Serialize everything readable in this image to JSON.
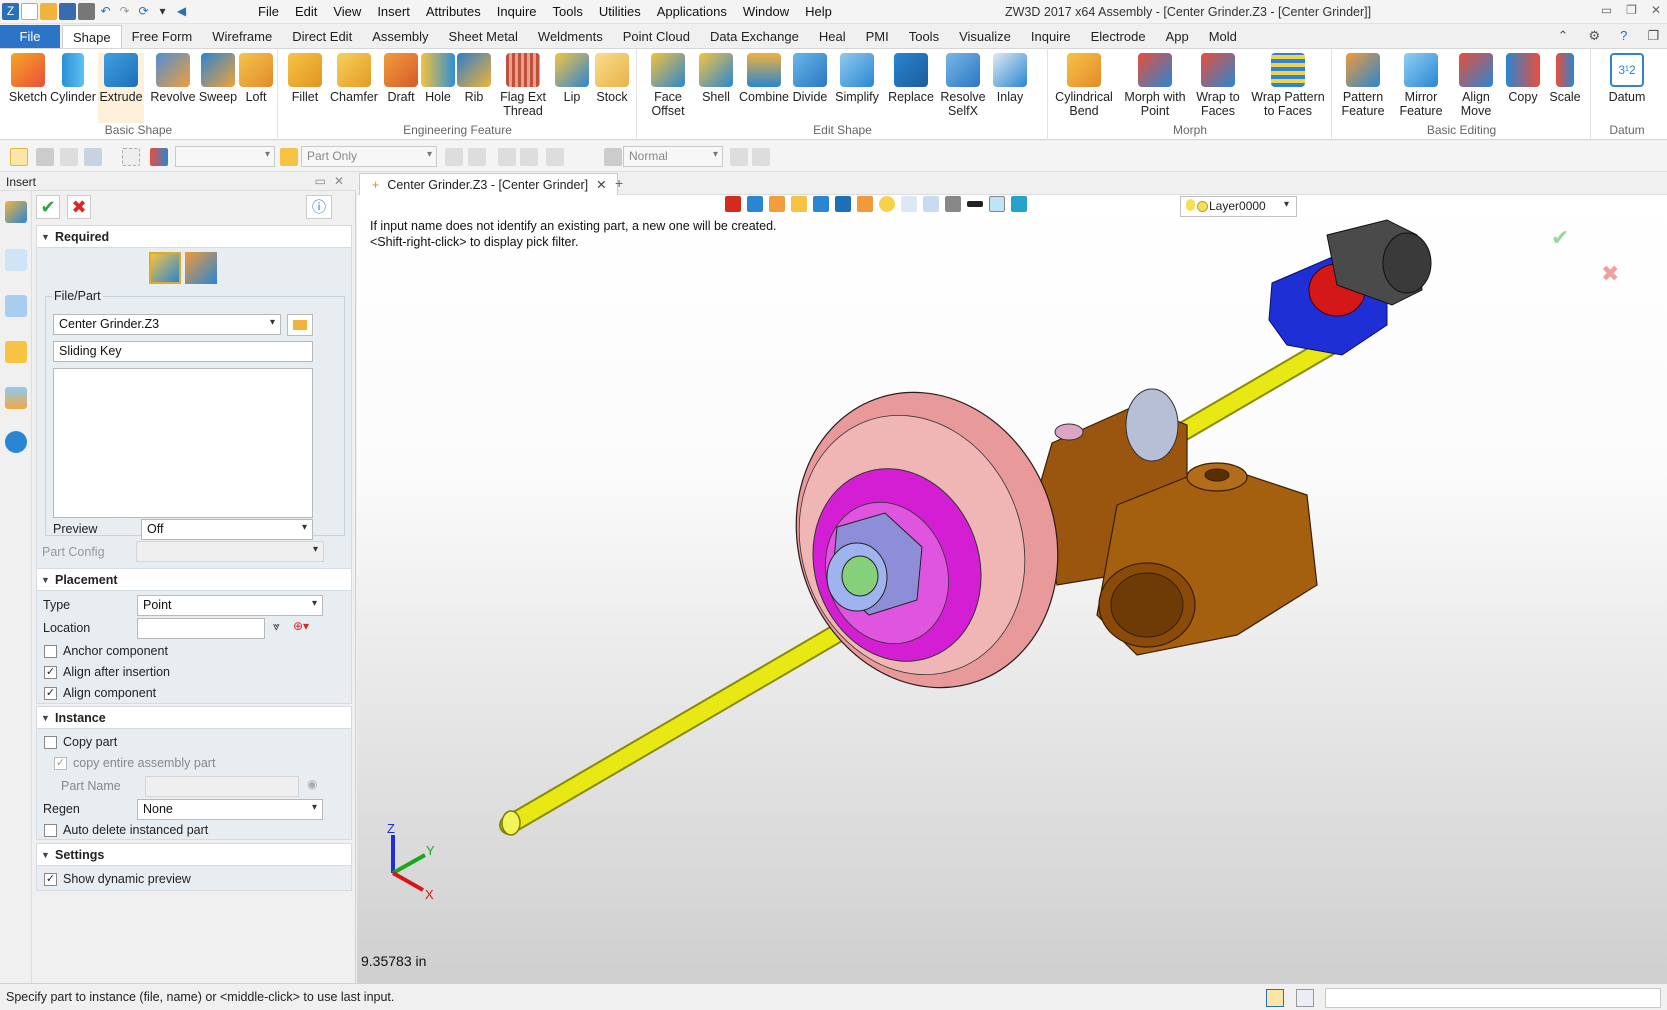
{
  "window": {
    "title": "ZW3D 2017  x64      Assembly - [Center Grinder.Z3 - [Center Grinder]]"
  },
  "menu": [
    "File",
    "Edit",
    "View",
    "Insert",
    "Attributes",
    "Inquire",
    "Tools",
    "Utilities",
    "Applications",
    "Window",
    "Help"
  ],
  "ribbon_tabs": {
    "file": "File",
    "tabs": [
      "Shape",
      "Free Form",
      "Wireframe",
      "Direct Edit",
      "Assembly",
      "Sheet Metal",
      "Weldments",
      "Point Cloud",
      "Data Exchange",
      "Heal",
      "PMI",
      "Tools",
      "Visualize",
      "Inquire",
      "Electrode",
      "App",
      "Mold"
    ],
    "active": "Shape"
  },
  "ribbon": {
    "basic_shape": {
      "label": "Basic Shape",
      "buttons": [
        "Sketch",
        "Cylinder",
        "Extrude",
        "Revolve",
        "Sweep",
        "Loft"
      ]
    },
    "engineering": {
      "label": "Engineering Feature",
      "buttons": [
        "Fillet",
        "Chamfer",
        "Draft",
        "Hole",
        "Rib",
        "Flag Ext\nThread",
        "Lip",
        "Stock"
      ]
    },
    "edit_shape": {
      "label": "Edit Shape",
      "buttons": [
        "Face\nOffset",
        "Shell",
        "Combine",
        "Divide",
        "Simplify",
        "Replace",
        "Resolve\nSelfX",
        "Inlay"
      ]
    },
    "morph": {
      "label": "Morph",
      "buttons": [
        "Cylindrical\nBend",
        "Morph with\nPoint",
        "Wrap to\nFaces",
        "Wrap Pattern\nto Faces"
      ]
    },
    "basic_editing": {
      "label": "Basic Editing",
      "buttons": [
        "Pattern\nFeature",
        "Mirror\nFeature",
        "Align\nMove",
        "Copy",
        "Scale"
      ]
    },
    "datum": {
      "label": "Datum",
      "buttons": [
        "Datum"
      ]
    }
  },
  "toolbar": {
    "filter_value": "",
    "part_only": "Part Only",
    "normal": "Normal"
  },
  "panel": {
    "title": "Insert",
    "required": "Required",
    "file_part": "File/Part",
    "file_value": "Center Grinder.Z3",
    "name_value": "Sliding Key",
    "preview_label": "Preview",
    "preview_value": "Off",
    "part_config": "Part Config",
    "placement": "Placement",
    "type_label": "Type",
    "type_value": "Point",
    "location_label": "Location",
    "anchor": "Anchor component",
    "align_after": "Align after insertion",
    "align_component": "Align component",
    "instance": "Instance",
    "copy_part": "Copy part",
    "copy_entire": "copy entire assembly part",
    "part_name": "Part  Name",
    "regen_label": "Regen",
    "regen_value": "None",
    "auto_delete": "Auto delete instanced part",
    "settings": "Settings",
    "show_preview": "Show dynamic preview"
  },
  "doc_tab": {
    "label": "Center Grinder.Z3 - [Center Grinder]"
  },
  "viewport": {
    "hint1": "If input name does not identify an existing part, a new one will be created.",
    "hint2": "<Shift-right-click> to display pick filter.",
    "layer": "Layer0000",
    "measure": "9.35783 in",
    "axes": {
      "x": "X",
      "y": "Y",
      "z": "Z"
    }
  },
  "status": {
    "text": "Specify part to instance (file, name) or <middle-click> to use last input."
  }
}
